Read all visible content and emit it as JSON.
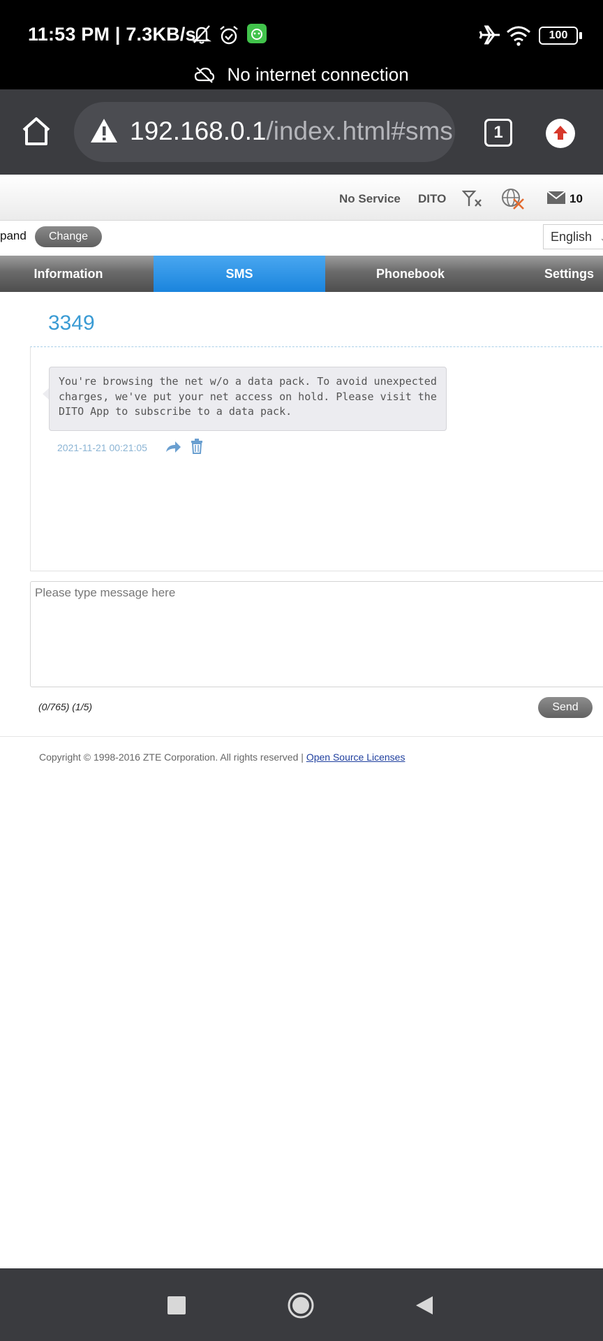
{
  "status_bar": {
    "time": "11:53 PM",
    "speed": "7.3KB/s",
    "battery": "100",
    "network_message": "No internet connection",
    "icons": [
      "bell-off-icon",
      "alarm-icon",
      "app-icon",
      "airplane-icon",
      "wifi-icon",
      "battery-icon"
    ]
  },
  "browser": {
    "url_host": "192.168.0.1",
    "url_path": "/index.html#sms",
    "tab_count": "1"
  },
  "router": {
    "status": {
      "service": "No Service",
      "carrier": "DITO",
      "message_count": "10"
    },
    "band_label": "pand",
    "change_button": "Change",
    "language": "English",
    "tabs": [
      {
        "label": "Information"
      },
      {
        "label": "SMS"
      },
      {
        "label": "Phonebook"
      },
      {
        "label": "Settings"
      }
    ],
    "active_tab": "SMS",
    "conversation": {
      "contact": "3349",
      "message": "You're browsing the net w/o a data pack. To avoid unexpected charges, we've put your net access on hold. Please visit the DITO App to subscribe to a data pack.",
      "date": "2021-11-21 00:21:05"
    },
    "composer": {
      "placeholder": "Please type message here",
      "counter": "(0/765) (1/5)",
      "send_button": "Send"
    },
    "footer": {
      "copyright": "Copyright © 1998-2016 ZTE Corporation. All rights reserved  |",
      "link": "Open Source Licenses"
    }
  },
  "colors": {
    "accent": "#3a9bd4",
    "active_tab": "#1a84dd",
    "chrome": "#3b3c40"
  }
}
